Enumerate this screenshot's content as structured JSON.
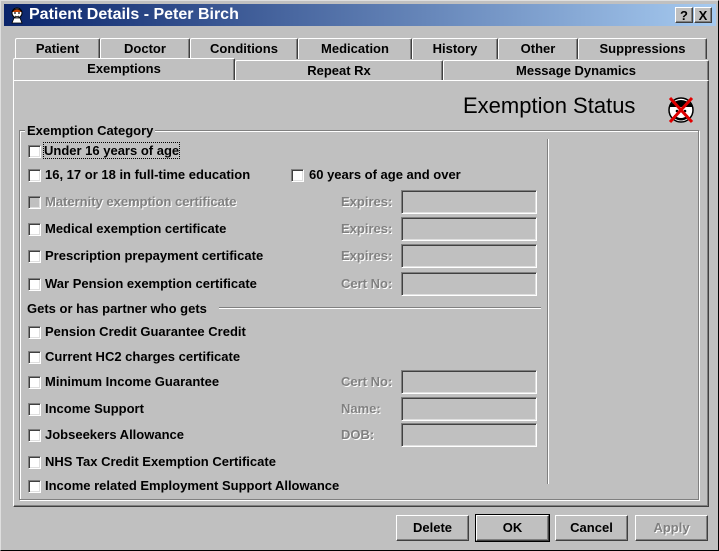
{
  "window": {
    "title": "Patient Details - Peter Birch",
    "help_label": "?",
    "close_label": "X"
  },
  "tabs_row1": [
    {
      "label": "Patient"
    },
    {
      "label": "Doctor"
    },
    {
      "label": "Conditions"
    },
    {
      "label": "Medication"
    },
    {
      "label": "History"
    },
    {
      "label": "Other"
    },
    {
      "label": "Suppressions"
    }
  ],
  "tabs_row2": [
    {
      "label": "Exemptions",
      "active": true
    },
    {
      "label": "Repeat Rx"
    },
    {
      "label": "Message Dynamics"
    }
  ],
  "header": {
    "title": "Exemption Status",
    "icon": "exempt-status-icon"
  },
  "exemption_category": {
    "label": "Exemption Category",
    "items": [
      {
        "label": "Under 16 years of age",
        "checked": false
      },
      {
        "label": "16, 17 or 18 in full-time education",
        "checked": false
      },
      {
        "label": "60 years of age and over",
        "checked": false
      },
      {
        "label": "Maternity exemption certificate",
        "checked": false,
        "disabled": true,
        "field_label": "Expires:"
      },
      {
        "label": "Medical exemption certificate",
        "checked": false,
        "field_label": "Expires:"
      },
      {
        "label": "Prescription prepayment certificate",
        "checked": false,
        "field_label": "Expires:"
      },
      {
        "label": "War Pension exemption certificate",
        "checked": false,
        "field_label": "Cert No:"
      }
    ]
  },
  "partner": {
    "label": "Gets or has partner who gets",
    "items": [
      {
        "label": "Pension Credit Guarantee Credit",
        "checked": false
      },
      {
        "label": "Current HC2 charges certificate",
        "checked": false
      },
      {
        "label": "Minimum Income Guarantee",
        "checked": false,
        "field_label": "Cert No:"
      },
      {
        "label": "Income Support",
        "checked": false,
        "field_label": "Name:"
      },
      {
        "label": "Jobseekers Allowance",
        "checked": false,
        "field_label": "DOB:"
      },
      {
        "label": "NHS Tax Credit Exemption Certificate",
        "checked": false
      },
      {
        "label": "Income related Employment Support Allowance",
        "checked": false
      }
    ]
  },
  "buttons": {
    "delete": "Delete",
    "ok": "OK",
    "cancel": "Cancel",
    "apply": "Apply"
  }
}
